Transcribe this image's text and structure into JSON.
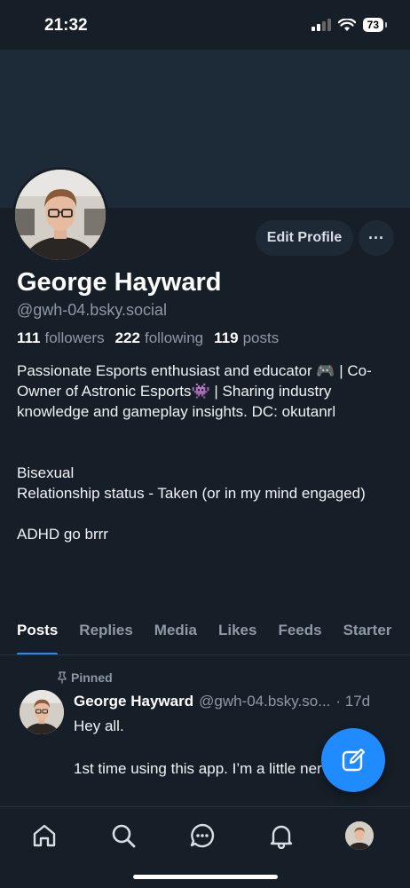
{
  "status_bar": {
    "time": "21:32",
    "battery": "73"
  },
  "profile": {
    "name": "George Hayward",
    "handle": "@gwh-04.bsky.social",
    "followers_count": "111",
    "followers_label": "followers",
    "following_count": "222",
    "following_label": "following",
    "posts_count": "119",
    "posts_label": "posts",
    "bio": "Passionate Esports enthusiast and educator 🎮 | Co-Owner of Astronic Esports👾 | Sharing industry knowledge and gameplay insights. DC: okutanrl\n\n\nBisexual\nRelationship status - Taken (or in my mind engaged)\n\nADHD go brrr"
  },
  "actions": {
    "edit_profile": "Edit Profile",
    "more": "···"
  },
  "tabs": [
    "Posts",
    "Replies",
    "Media",
    "Likes",
    "Feeds",
    "Starter"
  ],
  "active_tab": "Posts",
  "pinned_post": {
    "pinned_label": "Pinned",
    "author": "George Hayward",
    "handle": "@gwh-04.bsky.so...",
    "time": "· 17d",
    "text": "Hey all.\n\n1st time using this app. I’m a little nervous."
  },
  "icons": {
    "compose": "compose-icon",
    "home": "home-icon",
    "search": "search-icon",
    "chat": "chat-icon",
    "notifications": "bell-icon"
  },
  "colors": {
    "accent": "#208bfe",
    "background": "#161e27",
    "banner": "#1d2a38"
  }
}
